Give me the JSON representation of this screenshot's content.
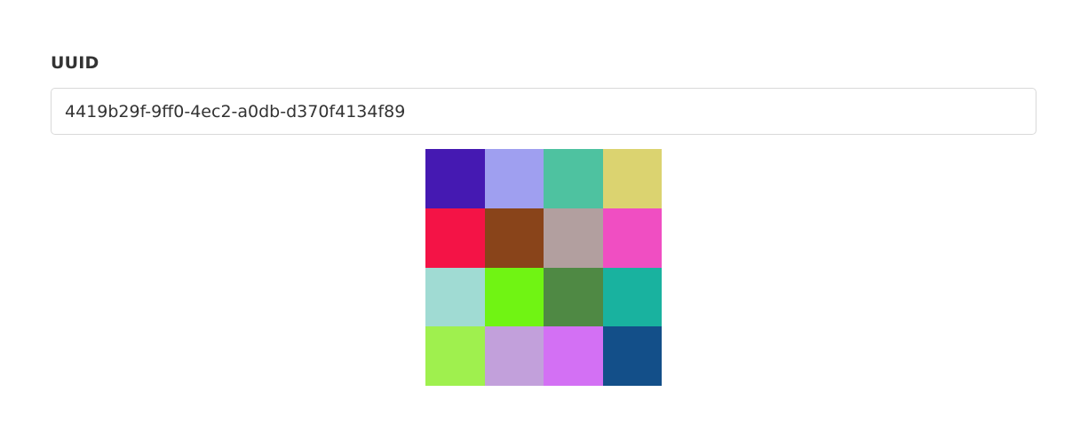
{
  "form": {
    "label": "UUID",
    "uuid_value": "4419b29f-9ff0-4ec2-a0db-d370f4134f89"
  },
  "identicon": {
    "rows": 4,
    "cols": 4,
    "colors": [
      "#4519b2",
      "#9f9ff0",
      "#4ec2a0",
      "#dbd370",
      "#f41346",
      "#89441a",
      "#b29f9f",
      "#f04ec2",
      "#a0dbd3",
      "#70f413",
      "#4f8944",
      "#19b29f",
      "#9ff04e",
      "#c2a0db",
      "#d370f4",
      "#134f89"
    ]
  }
}
